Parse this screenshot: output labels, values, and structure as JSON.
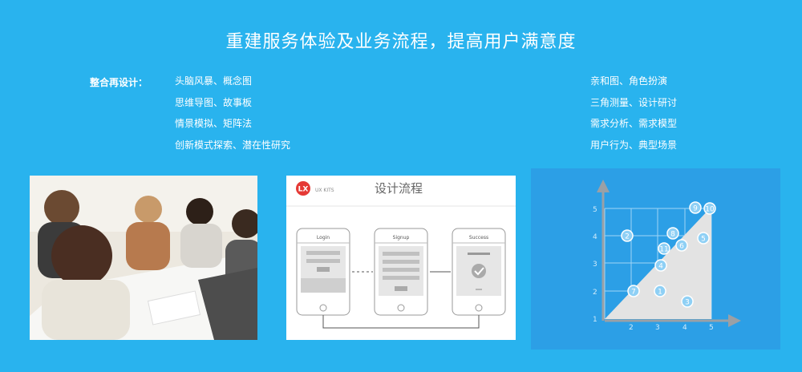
{
  "header": {
    "title": "重建服务体验及业务流程，提高用户满意度"
  },
  "section": {
    "label": "整合再设计：",
    "left_items": [
      "头脑风暴、概念图",
      "思维导图、故事板",
      "情景模拟、矩阵法",
      "创新模式探索、潜在性研究"
    ],
    "right_items": [
      "亲和图、角色扮演",
      "三角测量、设计研讨",
      "需求分析、需求模型",
      "用户行为、典型场景"
    ]
  },
  "flow_card": {
    "logo_text": "LX",
    "brand": "UX KITS",
    "title": "设计流程",
    "screens": [
      "Login",
      "Signup",
      "Success"
    ]
  },
  "graph_card": {
    "y_ticks": [
      "5",
      "4",
      "3",
      "2",
      "1"
    ],
    "x_ticks": [
      "2",
      "3",
      "4",
      "5"
    ],
    "points": [
      "9",
      "10",
      "2",
      "8",
      "5",
      "11",
      "6",
      "4",
      "7",
      "1",
      "3"
    ]
  },
  "colors": {
    "background": "#29b3ee",
    "graph_bg": "#2c9fe6",
    "logo": "#e53935"
  }
}
